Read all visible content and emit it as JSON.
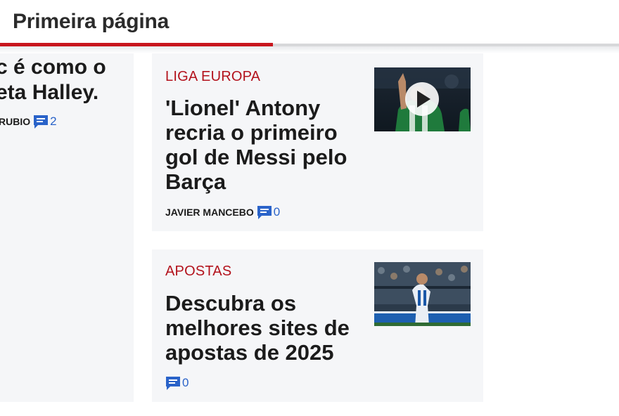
{
  "header": {
    "title": "Primeira página"
  },
  "left_card": {
    "headline_line1": "c é como o",
    "headline_line2": "eta Halley.",
    "author": "RUBIO",
    "comments": "2"
  },
  "articles": [
    {
      "category": "LIGA EUROPA",
      "headline": "'Lionel' Antony recria o primeiro gol de Messi pelo Barça",
      "author": "JAVIER MANCEBO",
      "comments": "0",
      "thumbnail_icon": "play-icon"
    },
    {
      "category": "APOSTAS",
      "headline": "Descubra os melhores sites de apostas de 2025",
      "author": "",
      "comments": "0"
    }
  ],
  "colors": {
    "accent_red": "#c8161d",
    "category_red": "#b3121c",
    "comment_blue": "#2a63c9",
    "card_bg": "#f5f6f8"
  }
}
